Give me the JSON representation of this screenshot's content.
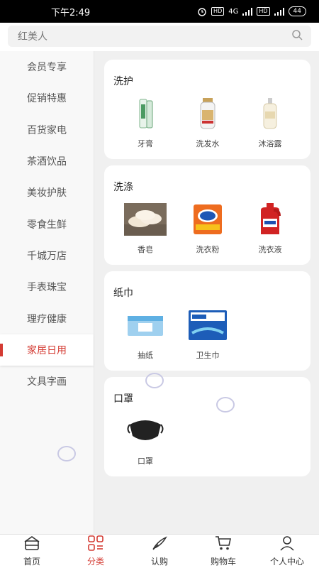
{
  "status_bar": {
    "time": "下午2:49",
    "network": "4G",
    "battery": "44",
    "hd1": "HD",
    "hd2": "HD"
  },
  "search": {
    "placeholder": "红美人"
  },
  "sidebar": {
    "items": [
      {
        "label": "会员专享"
      },
      {
        "label": "促销特惠"
      },
      {
        "label": "百货家电"
      },
      {
        "label": "茶酒饮品"
      },
      {
        "label": "美妆护肤"
      },
      {
        "label": "零食生鲜"
      },
      {
        "label": "千城万店"
      },
      {
        "label": "手表珠宝"
      },
      {
        "label": "理疗健康"
      },
      {
        "label": "家居日用"
      },
      {
        "label": "文具字画"
      }
    ],
    "active_index": 9
  },
  "sections": [
    {
      "title": "洗护",
      "items": [
        {
          "label": "牙膏"
        },
        {
          "label": "洗发水"
        },
        {
          "label": "沐浴露"
        }
      ]
    },
    {
      "title": "洗涤",
      "items": [
        {
          "label": "香皂"
        },
        {
          "label": "洗衣粉"
        },
        {
          "label": "洗衣液"
        }
      ]
    },
    {
      "title": "纸巾",
      "items": [
        {
          "label": "抽纸"
        },
        {
          "label": "卫生巾"
        }
      ]
    },
    {
      "title": "口罩",
      "items": [
        {
          "label": "口罩"
        }
      ]
    }
  ],
  "bottom_nav": {
    "items": [
      {
        "label": "首页"
      },
      {
        "label": "分类"
      },
      {
        "label": "认购"
      },
      {
        "label": "购物车"
      },
      {
        "label": "个人中心"
      }
    ],
    "active_index": 1
  },
  "colors": {
    "accent": "#d43b33"
  }
}
